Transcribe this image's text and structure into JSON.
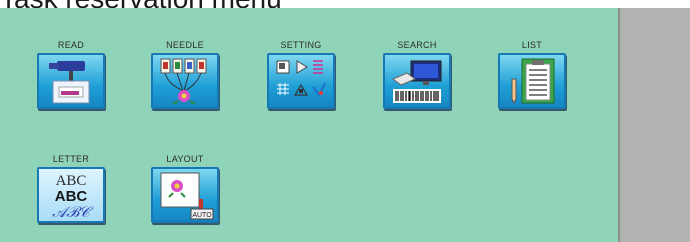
{
  "page": {
    "caption": "Task reservation menu"
  },
  "menu": {
    "items": [
      {
        "label": "READ",
        "icon": "read-icon"
      },
      {
        "label": "NEEDLE",
        "icon": "needle-icon"
      },
      {
        "label": "SETTING",
        "icon": "setting-icon"
      },
      {
        "label": "SEARCH",
        "icon": "search-icon"
      },
      {
        "label": "LIST",
        "icon": "list-icon"
      },
      {
        "label": "LETTER",
        "icon": "letter-icon",
        "glyphs": [
          "ABC",
          "ABC",
          "𝒜ℬ𝒞"
        ]
      },
      {
        "label": "LAYOUT",
        "icon": "layout-icon",
        "badge": "AUTO"
      }
    ]
  },
  "colors": {
    "panel": "#8fd3b8",
    "side_panel": "#b2b2b0",
    "button_top": "#7fd8f0",
    "button_bottom": "#1686c2"
  }
}
